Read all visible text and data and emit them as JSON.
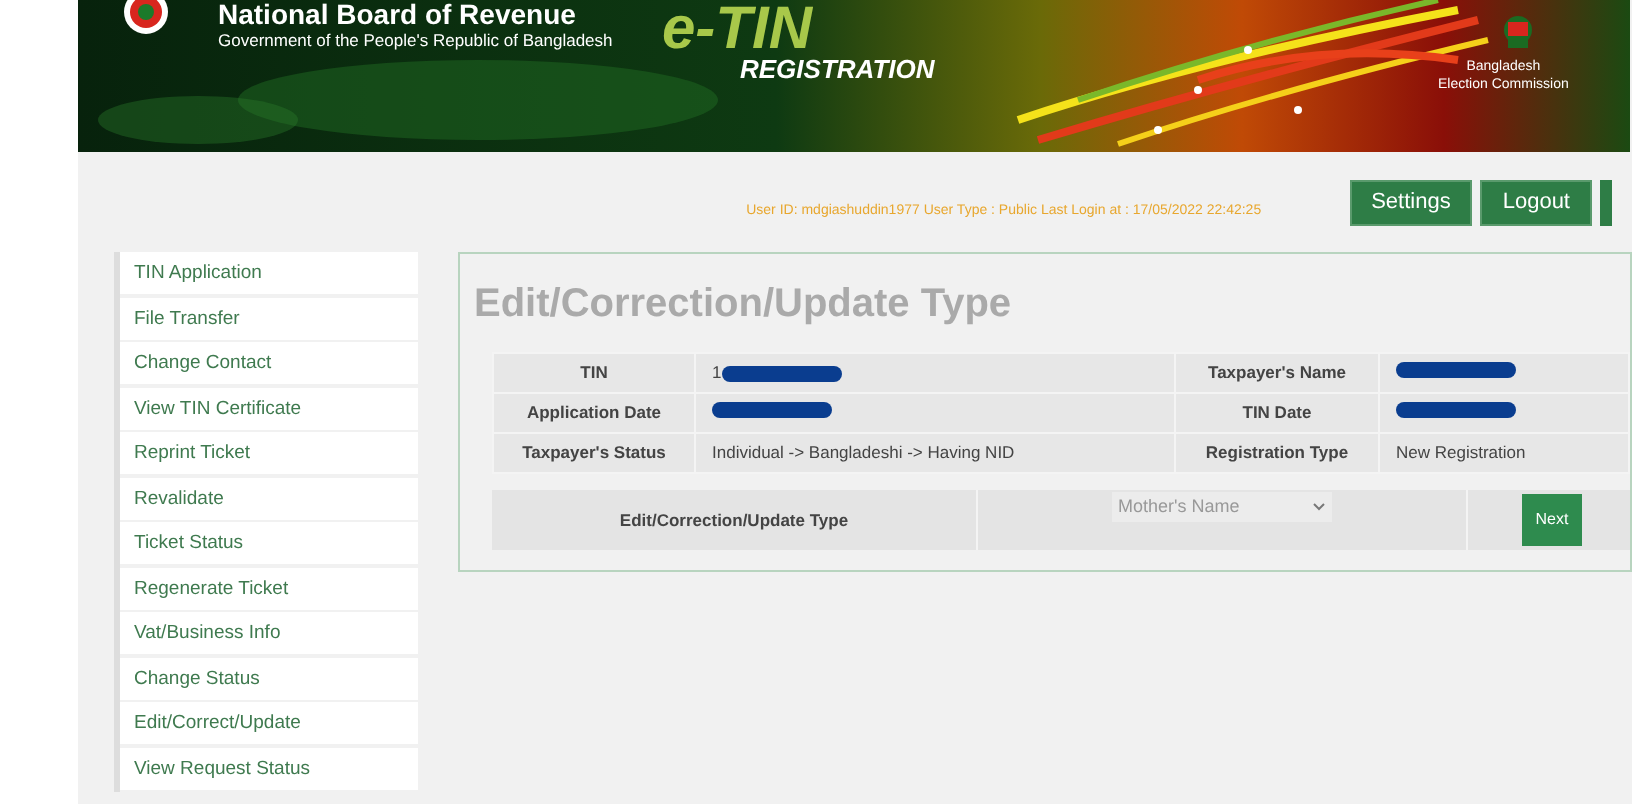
{
  "header": {
    "org_title": "National Board of Revenue",
    "org_subtitle": "Government of the People's Republic of Bangladesh",
    "app_title": "e-TIN",
    "app_subtitle": "REGISTRATION",
    "partner": [
      "Bangladesh",
      "Election Commission"
    ]
  },
  "user_info": "User ID: mdgiashuddin1977 User Type : Public Last Login at : 17/05/2022 22:42:25",
  "header_buttons": [
    "Settings",
    "Logout"
  ],
  "sidebar": {
    "items": [
      {
        "label": "TIN Application"
      },
      {
        "label": "File Transfer"
      },
      {
        "label": "Change Contact"
      },
      {
        "label": "View TIN Certificate"
      },
      {
        "label": "Reprint Ticket"
      },
      {
        "label": "Revalidate"
      },
      {
        "label": "Ticket Status"
      },
      {
        "label": "Regenerate Ticket"
      },
      {
        "label": "Vat/Business Info"
      },
      {
        "label": "Change Status"
      },
      {
        "label": "Edit/Correct/Update"
      },
      {
        "label": "View Request Status"
      }
    ]
  },
  "heading": "Edit/Correction/Update Type",
  "info_rows": [
    {
      "label_1": "TIN",
      "value_1": "1",
      "redacted_1": true,
      "label_2": "Taxpayer's Name",
      "value_2": "",
      "redacted_2": true
    },
    {
      "label_1": "Application Date",
      "value_1": "",
      "redacted_1": true,
      "label_2": "TIN Date",
      "value_2": "",
      "redacted_2": true
    },
    {
      "label_1": "Taxpayer's Status",
      "value_1": "Individual -> Bangladeshi -> Having NID",
      "redacted_1": false,
      "label_2": "Registration Type",
      "value_2": "New Registration",
      "redacted_2": false
    }
  ],
  "update_form": {
    "label": "Edit/Correction/Update Type",
    "select_value": "Mother's Name",
    "button": "Next"
  }
}
